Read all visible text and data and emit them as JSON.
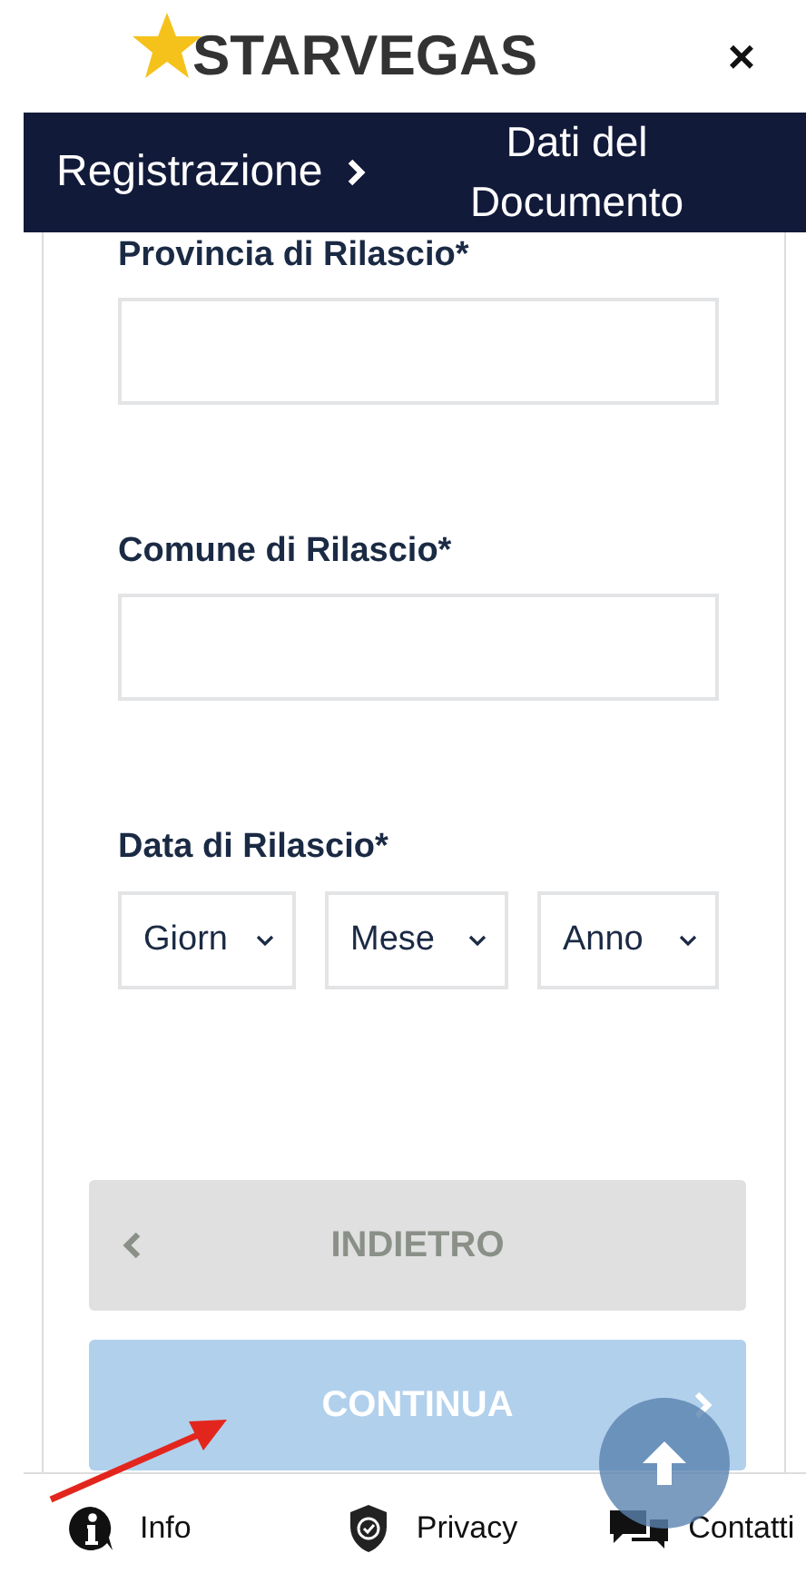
{
  "header": {
    "logo": "STARVEGAS",
    "close": "×"
  },
  "breadcrumb": {
    "parent": "Registrazione",
    "current": "Dati del Documento"
  },
  "fields": [
    {
      "kind": "text",
      "label": "Provincia di Rilascio*"
    },
    {
      "kind": "text",
      "label": "Comune di Rilascio*"
    },
    {
      "kind": "date",
      "label": "Data di Rilascio*",
      "selects": [
        "Giorn",
        "Mese",
        "Anno"
      ]
    }
  ],
  "buttons": [
    {
      "kind": "back",
      "label": "INDIETRO",
      "disabled": false
    },
    {
      "kind": "next",
      "label": "CONTINUA",
      "disabled": true
    }
  ],
  "footer": [
    {
      "kind": "info",
      "label": "Info"
    },
    {
      "kind": "privacy",
      "label": "Privacy"
    },
    {
      "kind": "chat",
      "label": "Contatti"
    }
  ]
}
